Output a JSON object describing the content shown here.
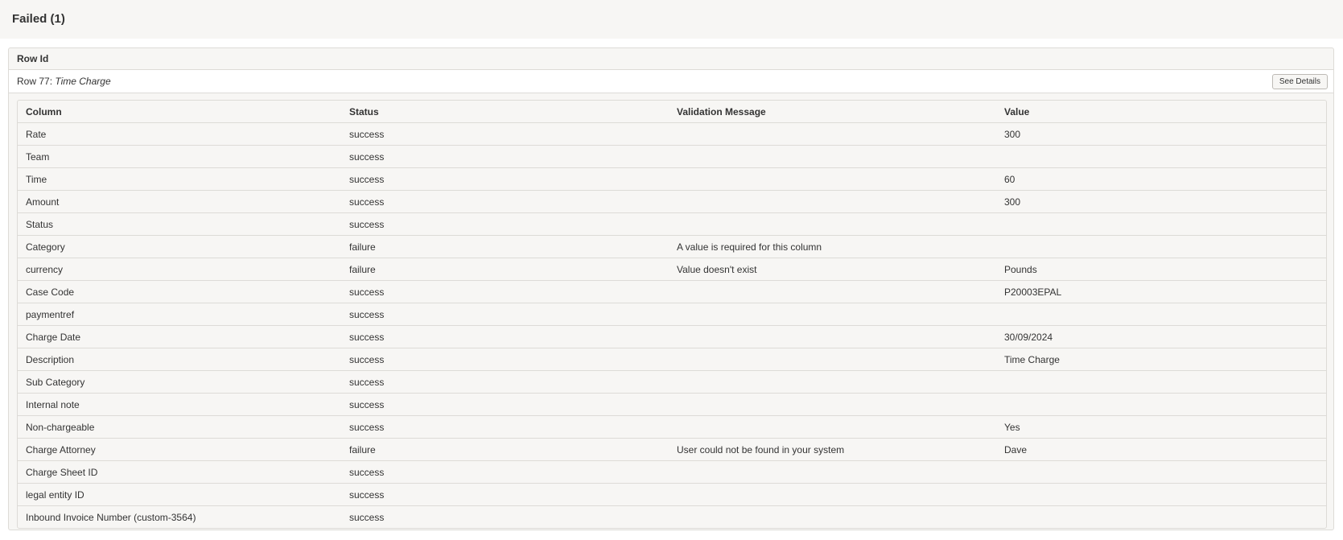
{
  "header": {
    "title": "Failed (1)"
  },
  "panel": {
    "heading": "Row Id",
    "row_prefix": "Row 77:",
    "row_name": "Time Charge",
    "see_details_label": "See Details"
  },
  "table": {
    "columns": [
      "Column",
      "Status",
      "Validation Message",
      "Value"
    ],
    "rows": [
      {
        "column": "Rate",
        "status": "success",
        "message": "",
        "value": "300"
      },
      {
        "column": "Team",
        "status": "success",
        "message": "",
        "value": ""
      },
      {
        "column": "Time",
        "status": "success",
        "message": "",
        "value": "60"
      },
      {
        "column": "Amount",
        "status": "success",
        "message": "",
        "value": "300"
      },
      {
        "column": "Status",
        "status": "success",
        "message": "",
        "value": ""
      },
      {
        "column": "Category",
        "status": "failure",
        "message": "A value is required for this column",
        "value": ""
      },
      {
        "column": "currency",
        "status": "failure",
        "message": "Value doesn't exist",
        "value": "Pounds"
      },
      {
        "column": "Case Code",
        "status": "success",
        "message": "",
        "value": "P20003EPAL"
      },
      {
        "column": "paymentref",
        "status": "success",
        "message": "",
        "value": ""
      },
      {
        "column": "Charge Date",
        "status": "success",
        "message": "",
        "value": "30/09/2024"
      },
      {
        "column": "Description",
        "status": "success",
        "message": "",
        "value": "Time Charge"
      },
      {
        "column": "Sub Category",
        "status": "success",
        "message": "",
        "value": ""
      },
      {
        "column": "Internal note",
        "status": "success",
        "message": "",
        "value": ""
      },
      {
        "column": "Non-chargeable",
        "status": "success",
        "message": "",
        "value": "Yes"
      },
      {
        "column": "Charge Attorney",
        "status": "failure",
        "message": "User could not be found in your system",
        "value": "Dave"
      },
      {
        "column": "Charge Sheet ID",
        "status": "success",
        "message": "",
        "value": ""
      },
      {
        "column": "legal entity ID",
        "status": "success",
        "message": "",
        "value": ""
      },
      {
        "column": "Inbound Invoice Number (custom-3564)",
        "status": "success",
        "message": "",
        "value": ""
      }
    ]
  }
}
